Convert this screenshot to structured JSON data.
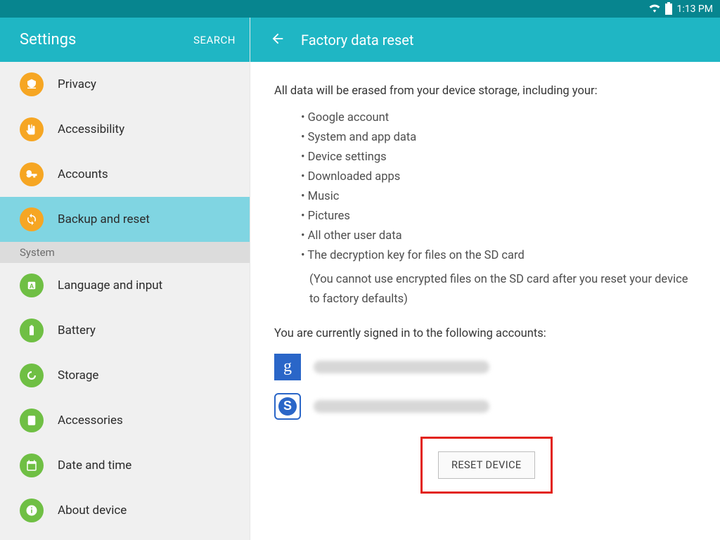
{
  "statusbar": {
    "time": "1:13 PM"
  },
  "sidebar": {
    "title": "Settings",
    "search_label": "SEARCH",
    "items": [
      {
        "label": "Privacy",
        "color": "orange",
        "icon": "privacy"
      },
      {
        "label": "Accessibility",
        "color": "orange",
        "icon": "hand"
      },
      {
        "label": "Accounts",
        "color": "orange",
        "icon": "key"
      },
      {
        "label": "Backup and reset",
        "color": "orange",
        "icon": "backup",
        "selected": true
      }
    ],
    "section_header": "System",
    "system_items": [
      {
        "label": "Language and input",
        "color": "green",
        "icon": "lang"
      },
      {
        "label": "Battery",
        "color": "green",
        "icon": "battery"
      },
      {
        "label": "Storage",
        "color": "green",
        "icon": "storage"
      },
      {
        "label": "Accessories",
        "color": "green",
        "icon": "accessories"
      },
      {
        "label": "Date and time",
        "color": "green",
        "icon": "date"
      },
      {
        "label": "About device",
        "color": "green",
        "icon": "info"
      }
    ]
  },
  "content": {
    "title": "Factory data reset",
    "intro": "All data will be erased from your device storage, including your:",
    "erase_items": [
      "Google account",
      "System and app data",
      "Device settings",
      "Downloaded apps",
      "Music",
      "Pictures",
      "All other user data",
      "The decryption key for files on the SD card"
    ],
    "sd_note": "(You cannot use encrypted files on the SD card after you reset your device to factory defaults)",
    "signed_in_label": "You are currently signed in to the following accounts:",
    "accounts": [
      {
        "type": "google",
        "glyph": "g"
      },
      {
        "type": "samsung",
        "glyph": "S"
      }
    ],
    "reset_button_label": "RESET DEVICE"
  }
}
